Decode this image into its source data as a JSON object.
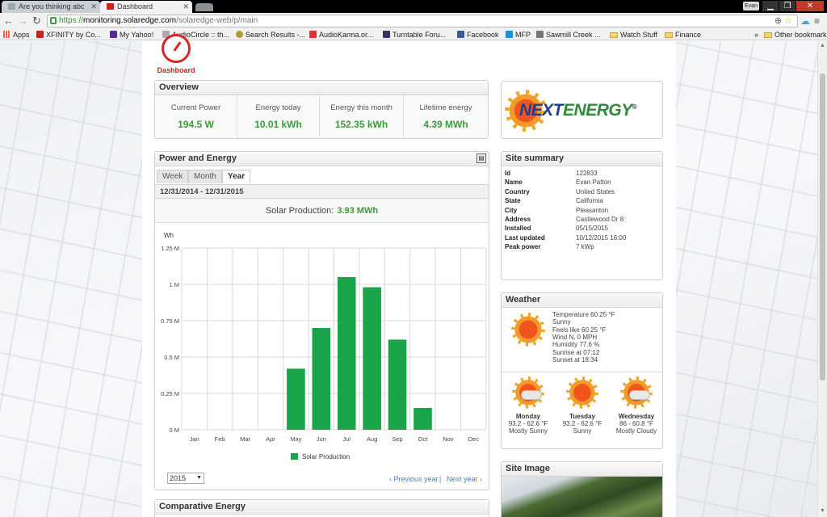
{
  "browser": {
    "tabs": [
      {
        "label": "Are you thinking abc",
        "active": false
      },
      {
        "label": "Dashboard",
        "active": true
      }
    ],
    "user": "Evan",
    "url_scheme": "https://",
    "url_domain": "monitoring.solaredge.com",
    "url_path": "/solaredge-web/p/main",
    "bookmarks": [
      {
        "label": "Apps",
        "icon": "apps-grid-icon"
      },
      {
        "label": "XFINITY by Co...",
        "icon": "xfinity-icon"
      },
      {
        "label": "My Yahoo!",
        "icon": "yahoo-icon"
      },
      {
        "label": "AudioCircle :: th...",
        "icon": "audiocircle-icon"
      },
      {
        "label": "Search Results -...",
        "icon": "search-results-icon"
      },
      {
        "label": "AudioKarma.or...",
        "icon": "audiokarma-icon"
      },
      {
        "label": "Turntable Foru...",
        "icon": "turntable-icon"
      },
      {
        "label": "Facebook",
        "icon": "facebook-icon"
      },
      {
        "label": "MFP",
        "icon": "mfp-icon"
      },
      {
        "label": "Sawmill Creek ...",
        "icon": "sawmill-icon"
      },
      {
        "label": "Watch Stuff",
        "icon": "folder-icon"
      },
      {
        "label": "Finance",
        "icon": "folder-icon"
      }
    ],
    "more_chevron": "»",
    "other_bookmarks": "Other bookmarks"
  },
  "dashboard_label": "Dashboard",
  "overview": {
    "title": "Overview",
    "cells": [
      {
        "label": "Current Power",
        "value": "194.5 W"
      },
      {
        "label": "Energy today",
        "value": "10.01 kWh"
      },
      {
        "label": "Energy this month",
        "value": "152.35 kWh"
      },
      {
        "label": "Lifetime energy",
        "value": "4.39 MWh"
      }
    ]
  },
  "logo": {
    "text_next": "NEXT",
    "text_energy": "ENERGY",
    "reg": "®"
  },
  "power_energy": {
    "title": "Power and Energy",
    "tabs": [
      "Week",
      "Month",
      "Year"
    ],
    "active_tab": "Year",
    "date_range": "12/31/2014 - 12/31/2015",
    "production_label": "Solar Production:",
    "production_value": "3.93 MWh",
    "year_select": "2015",
    "prev": "‹ Previous year",
    "sep": "|",
    "next": "Next year ›"
  },
  "chart_data": {
    "type": "bar",
    "ylabel": "Wh",
    "categories": [
      "Jan",
      "Feb",
      "Mar",
      "Apr",
      "May",
      "Jun",
      "Jul",
      "Aug",
      "Sep",
      "Oct",
      "Nov",
      "Dec"
    ],
    "series": [
      {
        "name": "Solar Production",
        "color": "#1aa54b",
        "values": [
          0,
          0,
          0,
          0,
          420000,
          700000,
          1050000,
          980000,
          620000,
          150000,
          0,
          0
        ]
      }
    ],
    "ylim": [
      0,
      1250000
    ],
    "yticks": [
      0,
      250000,
      500000,
      750000,
      1000000,
      1250000
    ],
    "ytick_labels": [
      "0 M",
      "0.25 M",
      "0.5 M",
      "0.75 M",
      "1 M",
      "1.25 M"
    ],
    "grid": true,
    "legend": "bottom"
  },
  "site_summary": {
    "title": "Site summary",
    "rows": [
      {
        "k": "Id",
        "v": "122833"
      },
      {
        "k": "Name",
        "v": "Evan Patton"
      },
      {
        "k": "Country",
        "v": "United States"
      },
      {
        "k": "State",
        "v": "California"
      },
      {
        "k": "City",
        "v": "Pleasanton"
      },
      {
        "k": "Address",
        "v": "Castlewood Dr 8"
      },
      {
        "k": "Installed",
        "v": "05/15/2015"
      },
      {
        "k": "Last updated",
        "v": "10/12/2015 16:00"
      },
      {
        "k": "Peak power",
        "v": "7 kWp"
      }
    ]
  },
  "weather": {
    "title": "Weather",
    "current": [
      "Temperature 60.25 °F",
      "Sunny",
      "Feels like 60.25 °F",
      "Wind N, 0 MPH",
      "Humidity 77.6 %",
      "Sunrise at 07:12",
      "Sunset at 18:34"
    ],
    "forecast": [
      {
        "day": "Monday",
        "temp": "93.2 - 62.6 °F",
        "desc": "Mostly Sunny"
      },
      {
        "day": "Tuesday",
        "temp": "93.2 - 62.6 °F",
        "desc": "Sunny"
      },
      {
        "day": "Wednesday",
        "temp": "86 - 60.8 °F",
        "desc": "Mostly Cloudy"
      }
    ]
  },
  "site_image": {
    "title": "Site Image"
  },
  "comparative": {
    "title": "Comparative Energy"
  }
}
